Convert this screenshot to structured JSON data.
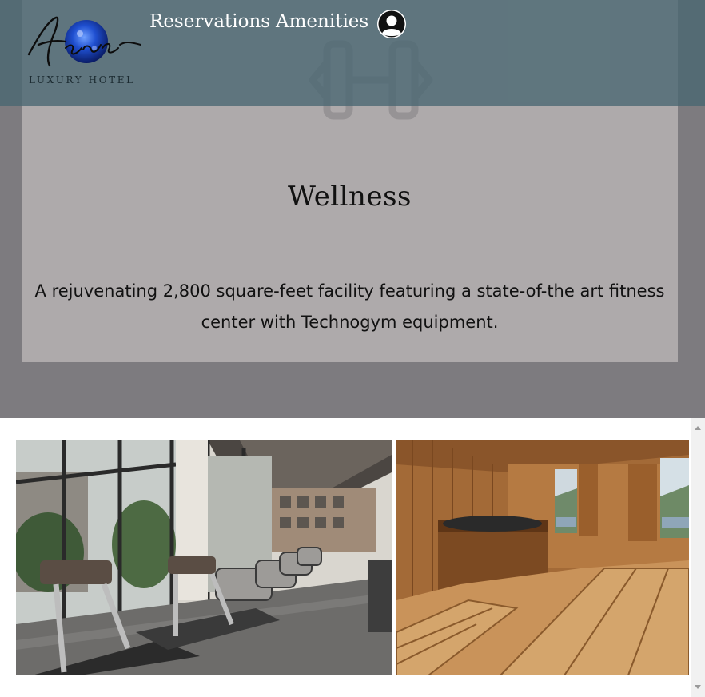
{
  "nav": {
    "logo_text": "Azure",
    "logo_subtitle": "LUXURY HOTEL",
    "reservations_label": "Reservations",
    "amenities_label": "Amenities",
    "profile_icon": "user-icon"
  },
  "hero": {
    "icon": "dumbbell-icon",
    "title": "Wellness",
    "description_line1": "A rejuvenating 2,800 square-feet facility featuring a state-of-the art fitness",
    "description_line2": "center with Technogym equipment."
  },
  "gallery": {
    "images": [
      "fitness-center-photo",
      "sauna-photo"
    ]
  },
  "colors": {
    "navbar": "#496771",
    "hero_background": "#7d7b7f",
    "hero_card": "#aeaaab",
    "logo_blue": "#1f4fd0"
  }
}
